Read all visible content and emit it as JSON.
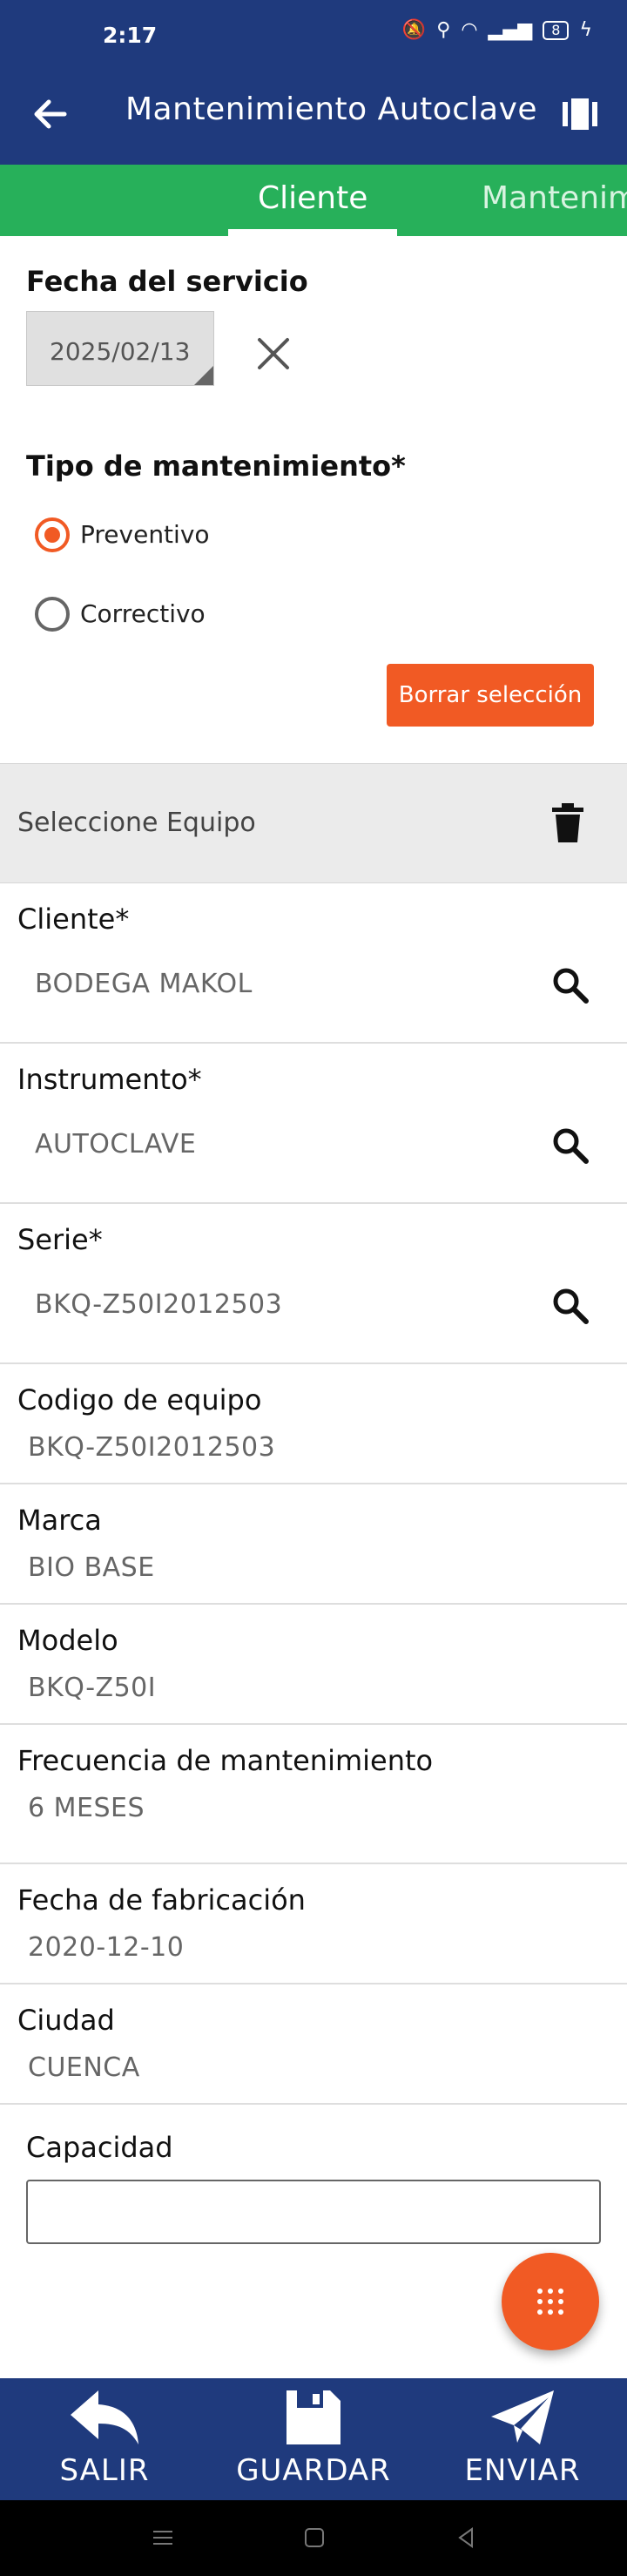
{
  "status_bar": {
    "time": "2:17",
    "battery": "8"
  },
  "app_bar": {
    "title": "Mantenimiento Autoclave"
  },
  "tabs": [
    {
      "label": "Cliente",
      "active": true
    },
    {
      "label": "Mantenim",
      "active": false
    }
  ],
  "service_date": {
    "label": "Fecha del servicio",
    "value": "2025/02/13"
  },
  "maintenance_type": {
    "label": "Tipo de mantenimiento*",
    "options": [
      {
        "label": "Preventivo",
        "selected": true
      },
      {
        "label": "Correctivo",
        "selected": false
      }
    ],
    "clear_button": "Borrar selección"
  },
  "equipment_bar": {
    "label": "Seleccione Equipo"
  },
  "fields": {
    "cliente": {
      "label": "Cliente*",
      "value": "BODEGA MAKOL"
    },
    "instrumento": {
      "label": "Instrumento*",
      "value": "AUTOCLAVE"
    },
    "serie": {
      "label": "Serie*",
      "value": "BKQ-Z50I2012503"
    },
    "codigo": {
      "label": "Codigo de equipo",
      "value": "BKQ-Z50I2012503"
    },
    "marca": {
      "label": "Marca",
      "value": "BIO BASE"
    },
    "modelo": {
      "label": "Modelo",
      "value": "BKQ-Z50I"
    },
    "frecuencia": {
      "label": "Frecuencia de mantenimiento",
      "value": "6 MESES"
    },
    "fabricacion": {
      "label": "Fecha de fabricación",
      "value": "2020-12-10"
    },
    "ciudad": {
      "label": "Ciudad",
      "value": "CUENCA"
    },
    "capacidad": {
      "label": "Capacidad",
      "value": ""
    }
  },
  "bottom_bar": {
    "exit": "SALIR",
    "save": "GUARDAR",
    "send": "ENVIAR"
  },
  "colors": {
    "primary": "#1f3a7d",
    "tab_green": "#27b05a",
    "accent": "#f15a24"
  }
}
